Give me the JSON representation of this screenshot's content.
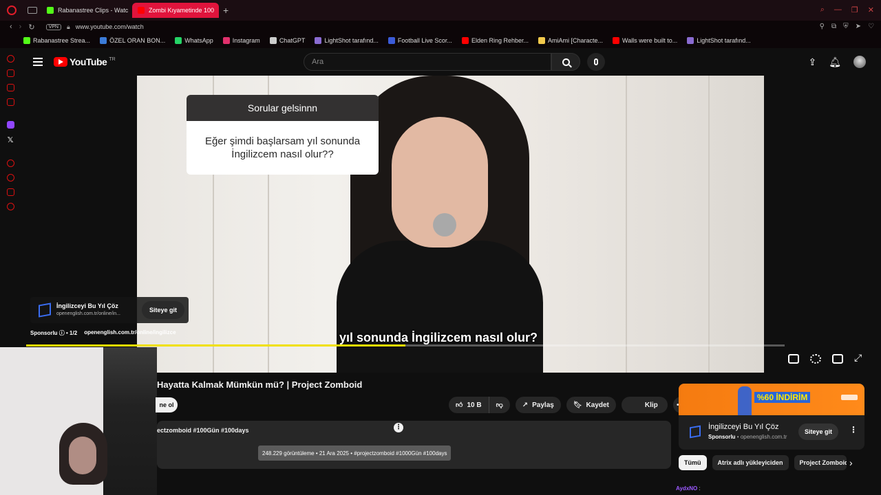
{
  "browser": {
    "tabs": [
      {
        "label": "Rabanastree Clips - Watch",
        "active": false
      },
      {
        "label": "Zombi Kıyametinde 100",
        "active": true
      }
    ],
    "new_tab": "+",
    "url": "www.youtube.com/watch",
    "vpn_label": "VPN",
    "bookmarks": [
      {
        "label": "Rabanastree Strea...",
        "color": "#53fc18"
      },
      {
        "label": "ÖZEL ORAN BON...",
        "color": "#3b7bd8"
      },
      {
        "label": "WhatsApp",
        "color": "#25d366"
      },
      {
        "label": "Instagram",
        "color": "#e1306c"
      },
      {
        "label": "ChatGPT",
        "color": "#cccccc"
      },
      {
        "label": "LightShot tarafınd...",
        "color": "#8a6bd1"
      },
      {
        "label": "Football Live Scor...",
        "color": "#3b5bd8"
      },
      {
        "label": "Elden Ring Rehber...",
        "color": "#ff0000"
      },
      {
        "label": "AmiAmi [Characte...",
        "color": "#f2c94c"
      },
      {
        "label": "Walls were built to...",
        "color": "#ff0000"
      },
      {
        "label": "LightShot tarafınd...",
        "color": "#8a6bd1"
      }
    ]
  },
  "youtube": {
    "brand": "YouTube",
    "region": "TR",
    "search_placeholder": "Ara"
  },
  "video": {
    "question_card": {
      "header": "Sorular gelsinnn",
      "body": "Eğer şimdi başlarsam yıl sonunda İngilizcem nasıl olur??"
    },
    "caption": "yıl sonunda İngilizcem nasıl olur?",
    "progress": 0.5
  },
  "ad_overlay": {
    "title": "İngilizceyi Bu Yıl Çöz",
    "url": "openenglish.com.tr/online/in...",
    "button": "Siteye git",
    "sponsored": "Sponsorlu",
    "counter": "• 1/2",
    "full_url": "openenglish.com.tr/online/ingilizce"
  },
  "below": {
    "title": "Hayatta Kalmak Mümkün mü? | Project Zomboid",
    "subscribe_partial": "ne ol",
    "likes": "10 B",
    "share": "Paylaş",
    "save": "Kaydet",
    "clip": "Klip",
    "more": "•••",
    "tags": "ectzomboid #100Gün #100days",
    "tooltip": "248.229 görüntüleme • 21 Ara 2025 • #projectzomboid #1000Gün #100days"
  },
  "sidebar_ad": {
    "banner_text": "%60 İNDİRİM",
    "title": "İngilizceyi Bu Yıl Çöz",
    "sponsored": "Sponsorlu",
    "domain": "• openenglish.com.tr",
    "button": "Siteye git"
  },
  "chips": [
    "Tümü",
    "Atrix adlı yükleyiciden",
    "Project Zomboid"
  ],
  "chat": {
    "user": "AydxNO",
    "sep": ":"
  }
}
